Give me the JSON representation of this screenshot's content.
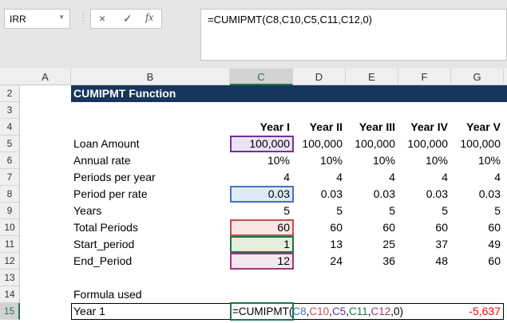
{
  "name_box": "IRR",
  "formula_bar": {
    "cancel_icon": "×",
    "enter_icon": "✓",
    "fx_label": "fx",
    "formula": "=CUMIPMT(C8,C10,C5,C11,C12,0)"
  },
  "columns": [
    "A",
    "B",
    "C",
    "D",
    "E",
    "F",
    "G"
  ],
  "rows": [
    "2",
    "3",
    "4",
    "5",
    "6",
    "7",
    "8",
    "9",
    "10",
    "11",
    "12",
    "13",
    "14",
    "15"
  ],
  "title": "CUMIPMT Function",
  "year_headers": [
    "Year I",
    "Year II",
    "Year III",
    "Year IV",
    "Year V"
  ],
  "table": [
    {
      "label": "Loan Amount",
      "values": [
        "100,000",
        "100,000",
        "100,000",
        "100,000",
        "100,000"
      ]
    },
    {
      "label": "Annual rate",
      "values": [
        "10%",
        "10%",
        "10%",
        "10%",
        "10%"
      ]
    },
    {
      "label": "Periods per year",
      "values": [
        "4",
        "4",
        "4",
        "4",
        "4"
      ]
    },
    {
      "label": "Period per rate",
      "values": [
        "0.03",
        "0.03",
        "0.03",
        "0.03",
        "0.03"
      ]
    },
    {
      "label": "Years",
      "values": [
        "5",
        "5",
        "5",
        "5",
        "5"
      ]
    },
    {
      "label": "Total Periods",
      "values": [
        "60",
        "60",
        "60",
        "60",
        "60"
      ]
    },
    {
      "label": "Start_period",
      "values": [
        "1",
        "13",
        "25",
        "37",
        "49"
      ]
    },
    {
      "label": "End_Period",
      "values": [
        "12",
        "24",
        "36",
        "48",
        "60"
      ]
    }
  ],
  "formula_used_label": "Formula used",
  "row15": {
    "label": "Year 1",
    "f_head": "=CUMIPMT(",
    "f_args": [
      "C8",
      ",",
      "C10",
      ",",
      "C5",
      ",",
      "C11",
      ",",
      "C12"
    ],
    "f_tail": ",0)",
    "result": "-5,637"
  },
  "colors": {
    "c5": "#7030a0",
    "c8": "#4472c4",
    "c10": "#c0504d",
    "c11": "#217346",
    "c12": "#a0367a",
    "negative": "#ff0000",
    "title_bg": "#17365d"
  }
}
